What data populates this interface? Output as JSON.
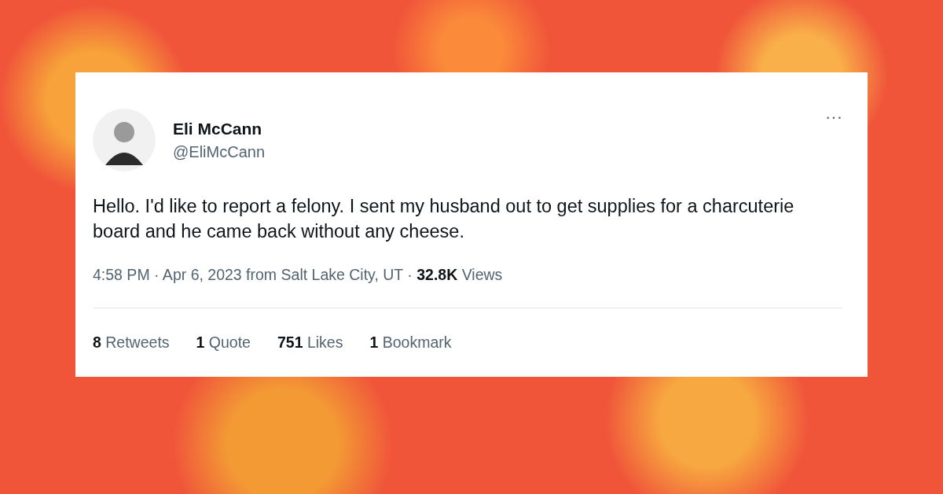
{
  "author": {
    "name": "Eli McCann",
    "handle": "@EliMcCann"
  },
  "more": "···",
  "text": "Hello. I'd like to report a felony. I sent my husband out to get supplies for a charcuterie board and he came back without any cheese.",
  "meta": "4:58 PM · Apr 6, 2023 from Salt Lake City, UT · **32.8K** Views",
  "stats": [
    {
      "count": "8",
      "label": "Retweets"
    },
    {
      "count": "1",
      "label": "Quote"
    },
    {
      "count": "751",
      "label": "Likes"
    },
    {
      "count": "1",
      "label": "Bookmark"
    }
  ]
}
